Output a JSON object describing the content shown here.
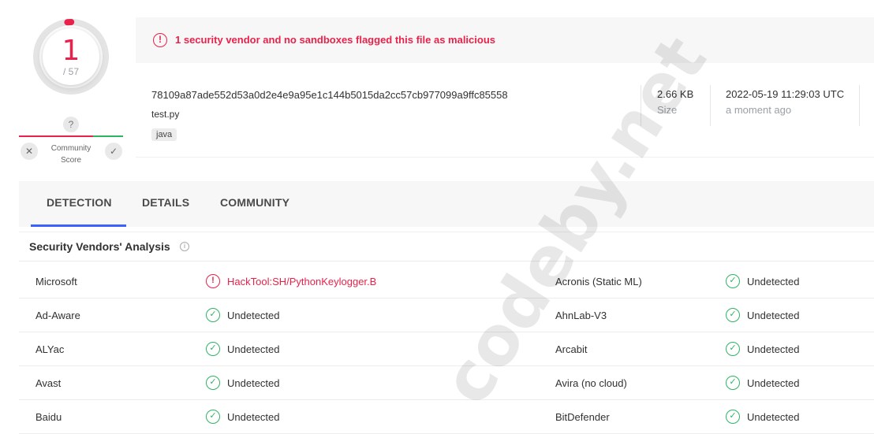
{
  "score": {
    "detections": "1",
    "total": "/ 57",
    "ring_fraction": 0.0175
  },
  "community": {
    "question": "?",
    "label_line1": "Community",
    "label_line2": "Score",
    "down_icon": "close-icon",
    "up_icon": "check-icon"
  },
  "alert": {
    "icon": "!",
    "text": "1 security vendor and no sandboxes flagged this file as malicious"
  },
  "file": {
    "hash": "78109a87ade552d53a0d2e4e9a95e1c144b5015da2cc57cb977099a9ffc85558",
    "name": "test.py",
    "tag": "java",
    "size_value": "2.66 KB",
    "size_label": "Size",
    "date_value": "2022-05-19 11:29:03 UTC",
    "date_label": "a moment ago"
  },
  "tabs": [
    {
      "label": "DETECTION",
      "active": true
    },
    {
      "label": "DETAILS",
      "active": false
    },
    {
      "label": "COMMUNITY",
      "active": false
    }
  ],
  "section": {
    "title": "Security Vendors' Analysis",
    "info_icon": "i"
  },
  "vendors": [
    {
      "left": {
        "name": "Microsoft",
        "result": "HackTool:SH/PythonKeylogger.B",
        "status": "malicious"
      },
      "right": {
        "name": "Acronis (Static ML)",
        "result": "Undetected",
        "status": "clean"
      }
    },
    {
      "left": {
        "name": "Ad-Aware",
        "result": "Undetected",
        "status": "clean"
      },
      "right": {
        "name": "AhnLab-V3",
        "result": "Undetected",
        "status": "clean"
      }
    },
    {
      "left": {
        "name": "ALYac",
        "result": "Undetected",
        "status": "clean"
      },
      "right": {
        "name": "Arcabit",
        "result": "Undetected",
        "status": "clean"
      }
    },
    {
      "left": {
        "name": "Avast",
        "result": "Undetected",
        "status": "clean"
      },
      "right": {
        "name": "Avira (no cloud)",
        "result": "Undetected",
        "status": "clean"
      }
    },
    {
      "left": {
        "name": "Baidu",
        "result": "Undetected",
        "status": "clean"
      },
      "right": {
        "name": "BitDefender",
        "result": "Undetected",
        "status": "clean"
      }
    }
  ],
  "icons": {
    "ok": "✓",
    "bad": "!"
  },
  "watermark": "codeby.net",
  "colors": {
    "malicious": "#e8224a",
    "clean": "#2fb463",
    "accent": "#3b61ff"
  }
}
